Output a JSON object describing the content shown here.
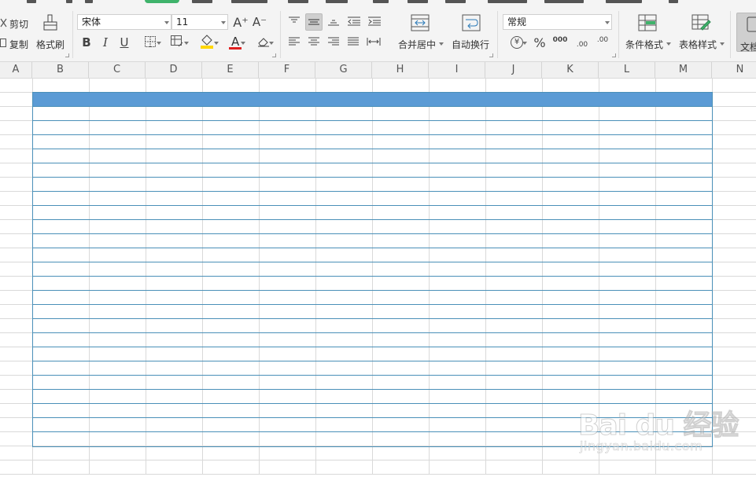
{
  "clipboard": {
    "cut_label": "剪切",
    "copy_label": "复制",
    "format_painter_label": "格式刷"
  },
  "font": {
    "name": "宋体",
    "size": "11",
    "grow_label": "A⁺",
    "shrink_label": "A⁻",
    "bold": "B",
    "italic": "I",
    "underline": "U",
    "font_color_letter": "A"
  },
  "alignment": {
    "merge_center_label": "合并居中",
    "wrap_text_label": "自动换行"
  },
  "number": {
    "format": "常规",
    "currency_symbol": "¥",
    "percent_symbol": "%",
    "thousands_symbol": "000",
    "inc_decimal": ".00",
    "dec_decimal": ".00"
  },
  "styles": {
    "conditional_format_label": "条件格式",
    "table_style_label": "表格样式",
    "doc_label": "文档"
  },
  "columns": [
    "A",
    "B",
    "C",
    "D",
    "E",
    "F",
    "G",
    "H",
    "I",
    "J",
    "K",
    "L",
    "M",
    "N"
  ],
  "watermark": {
    "main": "Bai du 经验",
    "sub": "jingyan.baidu.com"
  },
  "colors": {
    "banner": "#5b9bd5",
    "table_border": "#4a90b8",
    "grid": "#d9d9d9",
    "ribbon_bg": "#f4f4f4",
    "font_color": "#e02020",
    "fill_color": "#ffd700"
  }
}
